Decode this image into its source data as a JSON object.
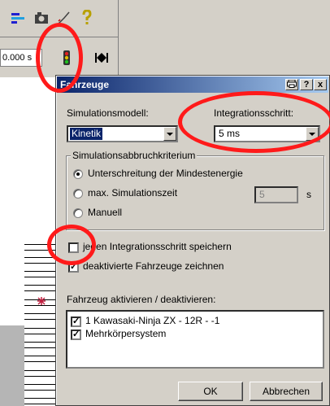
{
  "toolbar": {
    "time_value": "0.000 s",
    "icons": [
      "hierarchy-icon",
      "camera-icon",
      "curve-icon",
      "help-icon",
      "traffic-light-icon",
      "skip-end-icon"
    ]
  },
  "dialog": {
    "title": "Fahrzeuge",
    "title_buttons": [
      "print-icon",
      "?",
      "x"
    ],
    "sim_model_label": "Simulationsmodell:",
    "sim_model_value": "Kinetik",
    "integration_label": "Integrationsschritt:",
    "integration_value": "5 ms",
    "abort_group_label": "Simulationsabbruchkriterium",
    "abort_options": [
      {
        "label": "Unterschreitung der Mindestenergie",
        "selected": true
      },
      {
        "label": "max. Simulationszeit",
        "selected": false
      },
      {
        "label": "Manuell",
        "selected": false
      }
    ],
    "max_time_value": "5",
    "max_time_unit": "s",
    "checkboxes": [
      {
        "label": "jeden Integrationsschritt speichern",
        "checked": false
      },
      {
        "label": "deaktivierte Fahrzeuge zeichnen",
        "checked": true
      }
    ],
    "vehicles_label": "Fahrzeug aktivieren / deaktivieren:",
    "vehicles": [
      {
        "label": "1  Kawasaki-Ninja ZX - 12R - -1",
        "checked": true
      },
      {
        "label": "Mehrkörpersystem",
        "checked": true
      }
    ],
    "ok_label": "OK",
    "cancel_label": "Abbrechen"
  },
  "colors": {
    "annotation": "#ff1a1a",
    "title_start": "#0a246a",
    "title_end": "#a6caf0",
    "dialog_bg": "#d4d0c8"
  }
}
